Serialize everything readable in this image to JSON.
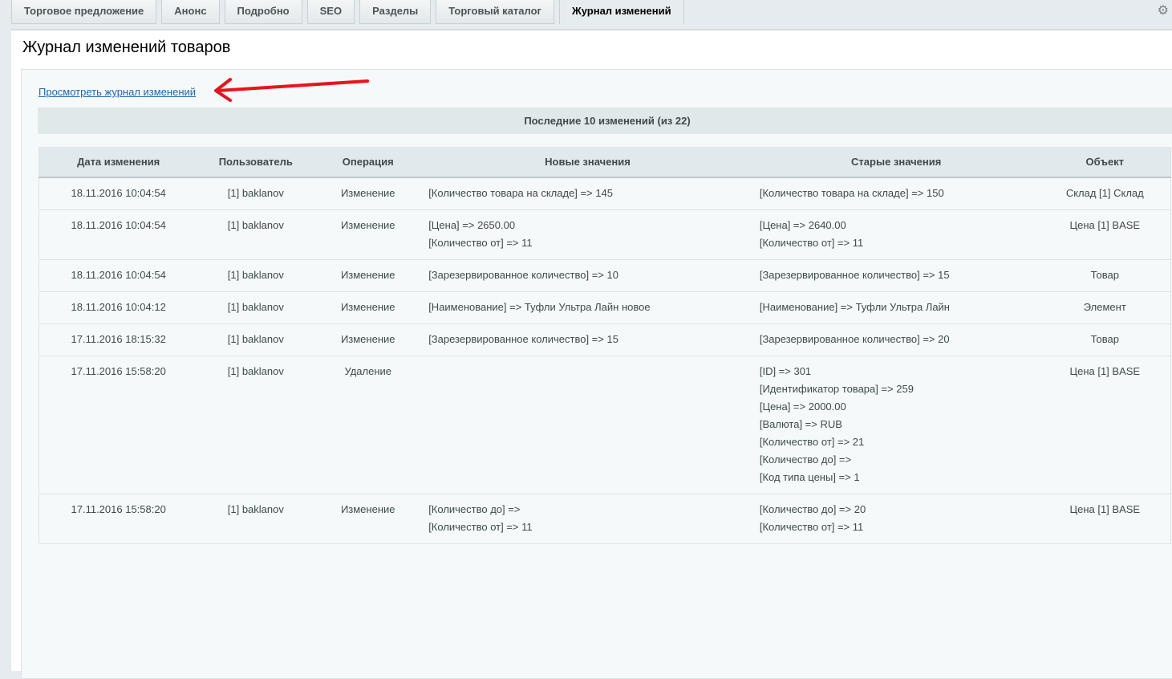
{
  "tabs": [
    "Торговое предложение",
    "Анонс",
    "Подробно",
    "SEO",
    "Разделы",
    "Торговый каталог",
    "Журнал изменений"
  ],
  "active_tab": 6,
  "title": "Журнал изменений товаров",
  "link": "Просмотреть журнал изменений",
  "caption": "Последние 10 изменений (из 22)",
  "columns": [
    "Дата изменения",
    "Пользователь",
    "Операция",
    "Новые значения",
    "Старые значения",
    "Объект"
  ],
  "rows": [
    {
      "date": "18.11.2016 10:04:54",
      "user": "[1] baklanov",
      "op": "Изменение",
      "new": [
        "[Количество товара на складе] => 145"
      ],
      "old": [
        "[Количество товара на складе] => 150"
      ],
      "obj": "Склад [1] Склад"
    },
    {
      "date": "18.11.2016 10:04:54",
      "user": "[1] baklanov",
      "op": "Изменение",
      "new": [
        "[Цена] => 2650.00",
        "[Количество от] => 11"
      ],
      "old": [
        "[Цена] => 2640.00",
        "[Количество от] => 11"
      ],
      "obj": "Цена [1] BASE"
    },
    {
      "date": "18.11.2016 10:04:54",
      "user": "[1] baklanov",
      "op": "Изменение",
      "new": [
        "[Зарезервированное количество] => 10"
      ],
      "old": [
        "[Зарезервированное количество] => 15"
      ],
      "obj": "Товар"
    },
    {
      "date": "18.11.2016 10:04:12",
      "user": "[1] baklanov",
      "op": "Изменение",
      "new": [
        "[Наименование] => Туфли Ультра Лайн новое"
      ],
      "old": [
        "[Наименование] => Туфли Ультра Лайн"
      ],
      "obj": "Элемент"
    },
    {
      "date": "17.11.2016 18:15:32",
      "user": "[1] baklanov",
      "op": "Изменение",
      "new": [
        "[Зарезервированное количество] => 15"
      ],
      "old": [
        "[Зарезервированное количество] => 20"
      ],
      "obj": "Товар"
    },
    {
      "date": "17.11.2016 15:58:20",
      "user": "[1] baklanov",
      "op": "Удаление",
      "new": [],
      "old": [
        "[ID] => 301",
        "[Идентификатор товара] => 259",
        "[Цена] => 2000.00",
        "[Валюта] => RUB",
        "[Количество от] => 21",
        "[Количество до] =>",
        "[Код типа цены] => 1"
      ],
      "obj": "Цена [1] BASE"
    },
    {
      "date": "17.11.2016 15:58:20",
      "user": "[1] baklanov",
      "op": "Изменение",
      "new": [
        "[Количество до] =>",
        "[Количество от] => 11"
      ],
      "old": [
        "[Количество до] => 20",
        "[Количество от] => 11"
      ],
      "obj": "Цена [1] BASE"
    }
  ]
}
